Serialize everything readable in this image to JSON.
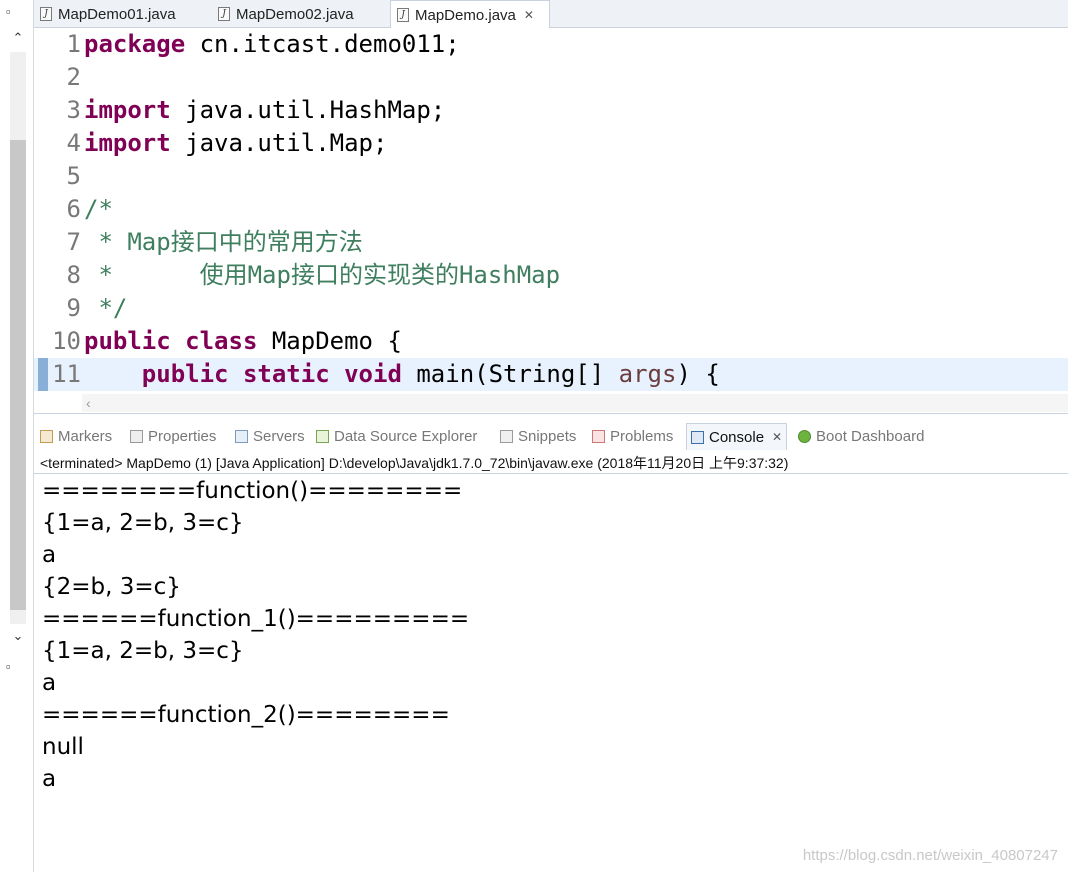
{
  "editor_tabs": [
    {
      "label": "MapDemo01.java",
      "active": false
    },
    {
      "label": "MapDemo02.java",
      "active": false
    },
    {
      "label": "MapDemo.java",
      "active": true
    }
  ],
  "code_lines": [
    {
      "num": "1",
      "parts": [
        {
          "t": "package",
          "k": "kw"
        },
        {
          "t": " cn.itcast.demo011;",
          "k": ""
        }
      ]
    },
    {
      "num": "2",
      "parts": []
    },
    {
      "num": "3",
      "parts": [
        {
          "t": "import",
          "k": "kw"
        },
        {
          "t": " java.util.HashMap;",
          "k": ""
        }
      ]
    },
    {
      "num": "4",
      "parts": [
        {
          "t": "import",
          "k": "kw"
        },
        {
          "t": " java.util.Map;",
          "k": ""
        }
      ]
    },
    {
      "num": "5",
      "parts": []
    },
    {
      "num": "6",
      "parts": [
        {
          "t": "/*",
          "k": "cm"
        }
      ]
    },
    {
      "num": "7",
      "parts": [
        {
          "t": " * Map接口中的常用方法",
          "k": "cm"
        }
      ]
    },
    {
      "num": "8",
      "parts": [
        {
          "t": " *      使用Map接口的实现类的HashMap",
          "k": "cm"
        }
      ]
    },
    {
      "num": "9",
      "parts": [
        {
          "t": " */",
          "k": "cm"
        }
      ]
    },
    {
      "num": "10",
      "parts": [
        {
          "t": "public",
          "k": "kw"
        },
        {
          "t": " ",
          "k": ""
        },
        {
          "t": "class",
          "k": "kw"
        },
        {
          "t": " MapDemo {",
          "k": ""
        }
      ]
    },
    {
      "num": "11",
      "current": true,
      "parts": [
        {
          "t": "    ",
          "k": ""
        },
        {
          "t": "public",
          "k": "kw"
        },
        {
          "t": " ",
          "k": ""
        },
        {
          "t": "static",
          "k": "kw"
        },
        {
          "t": " ",
          "k": ""
        },
        {
          "t": "void",
          "k": "kw"
        },
        {
          "t": " main(String[] ",
          "k": ""
        },
        {
          "t": "args",
          "k": "param"
        },
        {
          "t": ") {",
          "k": ""
        }
      ]
    }
  ],
  "view_tabs": [
    {
      "label": "Markers",
      "icon": "markers-icon",
      "active": false
    },
    {
      "label": "Properties",
      "icon": "properties-icon",
      "active": false
    },
    {
      "label": "Servers",
      "icon": "servers-icon",
      "active": false
    },
    {
      "label": "Data Source Explorer",
      "icon": "data-source-explorer-icon",
      "active": false
    },
    {
      "label": "Snippets",
      "icon": "snippets-icon",
      "active": false
    },
    {
      "label": "Problems",
      "icon": "problems-icon",
      "active": false
    },
    {
      "label": "Console",
      "icon": "console-icon",
      "active": true
    },
    {
      "label": "Boot Dashboard",
      "icon": "boot-dashboard-icon",
      "active": false
    }
  ],
  "console": {
    "status": "<terminated> MapDemo (1) [Java Application] D:\\develop\\Java\\jdk1.7.0_72\\bin\\javaw.exe (2018年11月20日 上午9:37:32)",
    "output": [
      "========function()========",
      "{1=a, 2=b, 3=c}",
      "a",
      "{2=b, 3=c}",
      "======function_1()=========",
      "{1=a, 2=b, 3=c}",
      "a",
      "======function_2()========",
      "null",
      "a"
    ]
  },
  "watermark": "https://blog.csdn.net/weixin_40807247",
  "colors": {
    "keyword": "#7f0055",
    "comment": "#3f7f5f",
    "current_line": "#e8f2fe"
  }
}
